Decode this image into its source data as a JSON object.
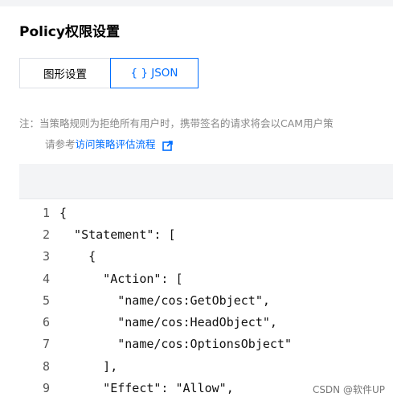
{
  "page": {
    "title": "Policy权限设置"
  },
  "tabs": [
    {
      "label": "图形设置",
      "active": false
    },
    {
      "label": "{ } JSON",
      "active": true
    }
  ],
  "note": {
    "line1": "注：当策略规则为拒绝所有用户时，携带签名的请求将会以CAM用户策",
    "line2_prefix": "请参考",
    "link": "访问策略评估流程",
    "link_icon": "external-link-icon"
  },
  "editor": {
    "lines": [
      {
        "num": "1",
        "text": "{"
      },
      {
        "num": "2",
        "text": "  \"Statement\": ["
      },
      {
        "num": "3",
        "text": "    {"
      },
      {
        "num": "4",
        "text": "      \"Action\": ["
      },
      {
        "num": "5",
        "text": "        \"name/cos:GetObject\","
      },
      {
        "num": "6",
        "text": "        \"name/cos:HeadObject\","
      },
      {
        "num": "7",
        "text": "        \"name/cos:OptionsObject\""
      },
      {
        "num": "8",
        "text": "      ],"
      },
      {
        "num": "9",
        "text": "      \"Effect\": \"Allow\","
      }
    ]
  },
  "watermark": "CSDN @软件UP",
  "colors": {
    "accent": "#006eff",
    "note": "#888888"
  }
}
